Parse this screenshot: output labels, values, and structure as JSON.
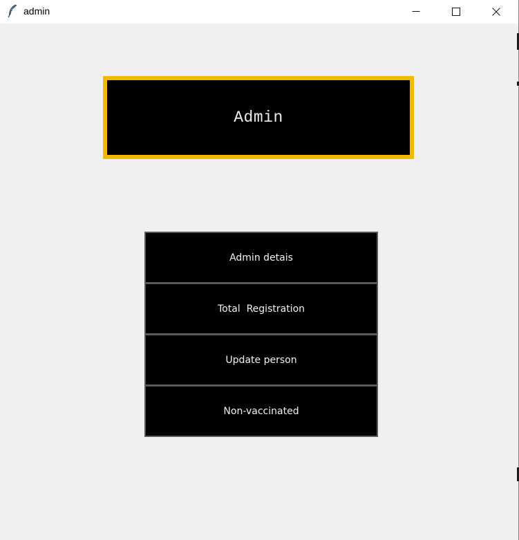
{
  "window": {
    "title": "admin",
    "icon": "feather-icon",
    "controls": {
      "minimize": "minimize-icon",
      "maximize": "maximize-icon",
      "close": "close-icon"
    }
  },
  "header": {
    "title": "Admin",
    "border_color": "#f5b800",
    "background": "#000000"
  },
  "menu": {
    "buttons": [
      {
        "label": "Admin detais"
      },
      {
        "label": "Total  Registration"
      },
      {
        "label": "Update person"
      },
      {
        "label": "Non-vaccinated"
      }
    ]
  },
  "colors": {
    "window_bg": "#f0f0f0",
    "titlebar_bg": "#ffffff",
    "button_bg": "#000000",
    "button_text": "#f2f2f2"
  }
}
